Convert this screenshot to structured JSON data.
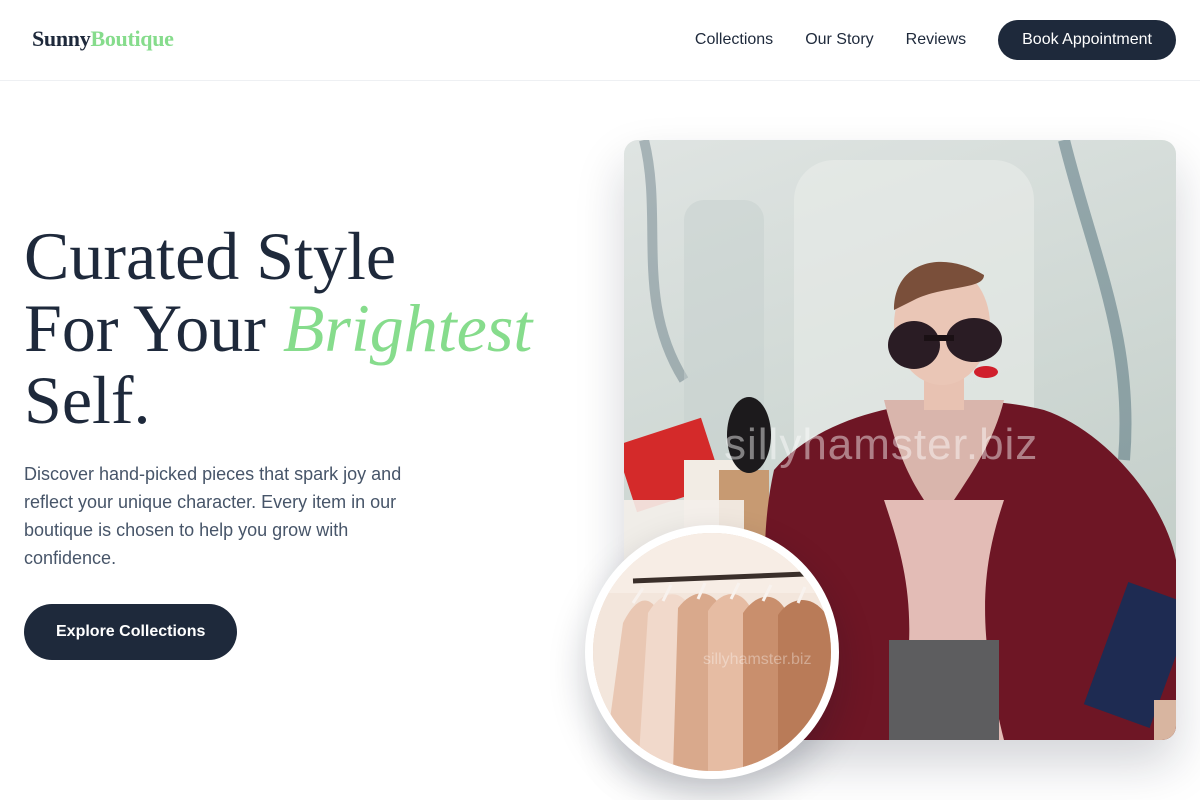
{
  "brand": {
    "part1": "Sunny",
    "part2": "Boutique"
  },
  "nav": {
    "links": [
      "Collections",
      "Our Story",
      "Reviews"
    ],
    "cta": "Book Appointment"
  },
  "hero": {
    "title_line1": "Curated Style",
    "title_line2_prefix": "For Your ",
    "title_accent": "Brightest",
    "title_line3": "Self.",
    "description": "Discover hand-picked pieces that spark joy and reflect your unique character. Every item in our boutique is chosen to help you grow with confidence.",
    "cta": "Explore Collections"
  },
  "images": {
    "main_watermark": "sillyhamster.biz",
    "circle_watermark": "sillyhamster.biz"
  },
  "colors": {
    "primary": "#1e293b",
    "accent": "#86dc8c",
    "muted_text": "#475569"
  }
}
